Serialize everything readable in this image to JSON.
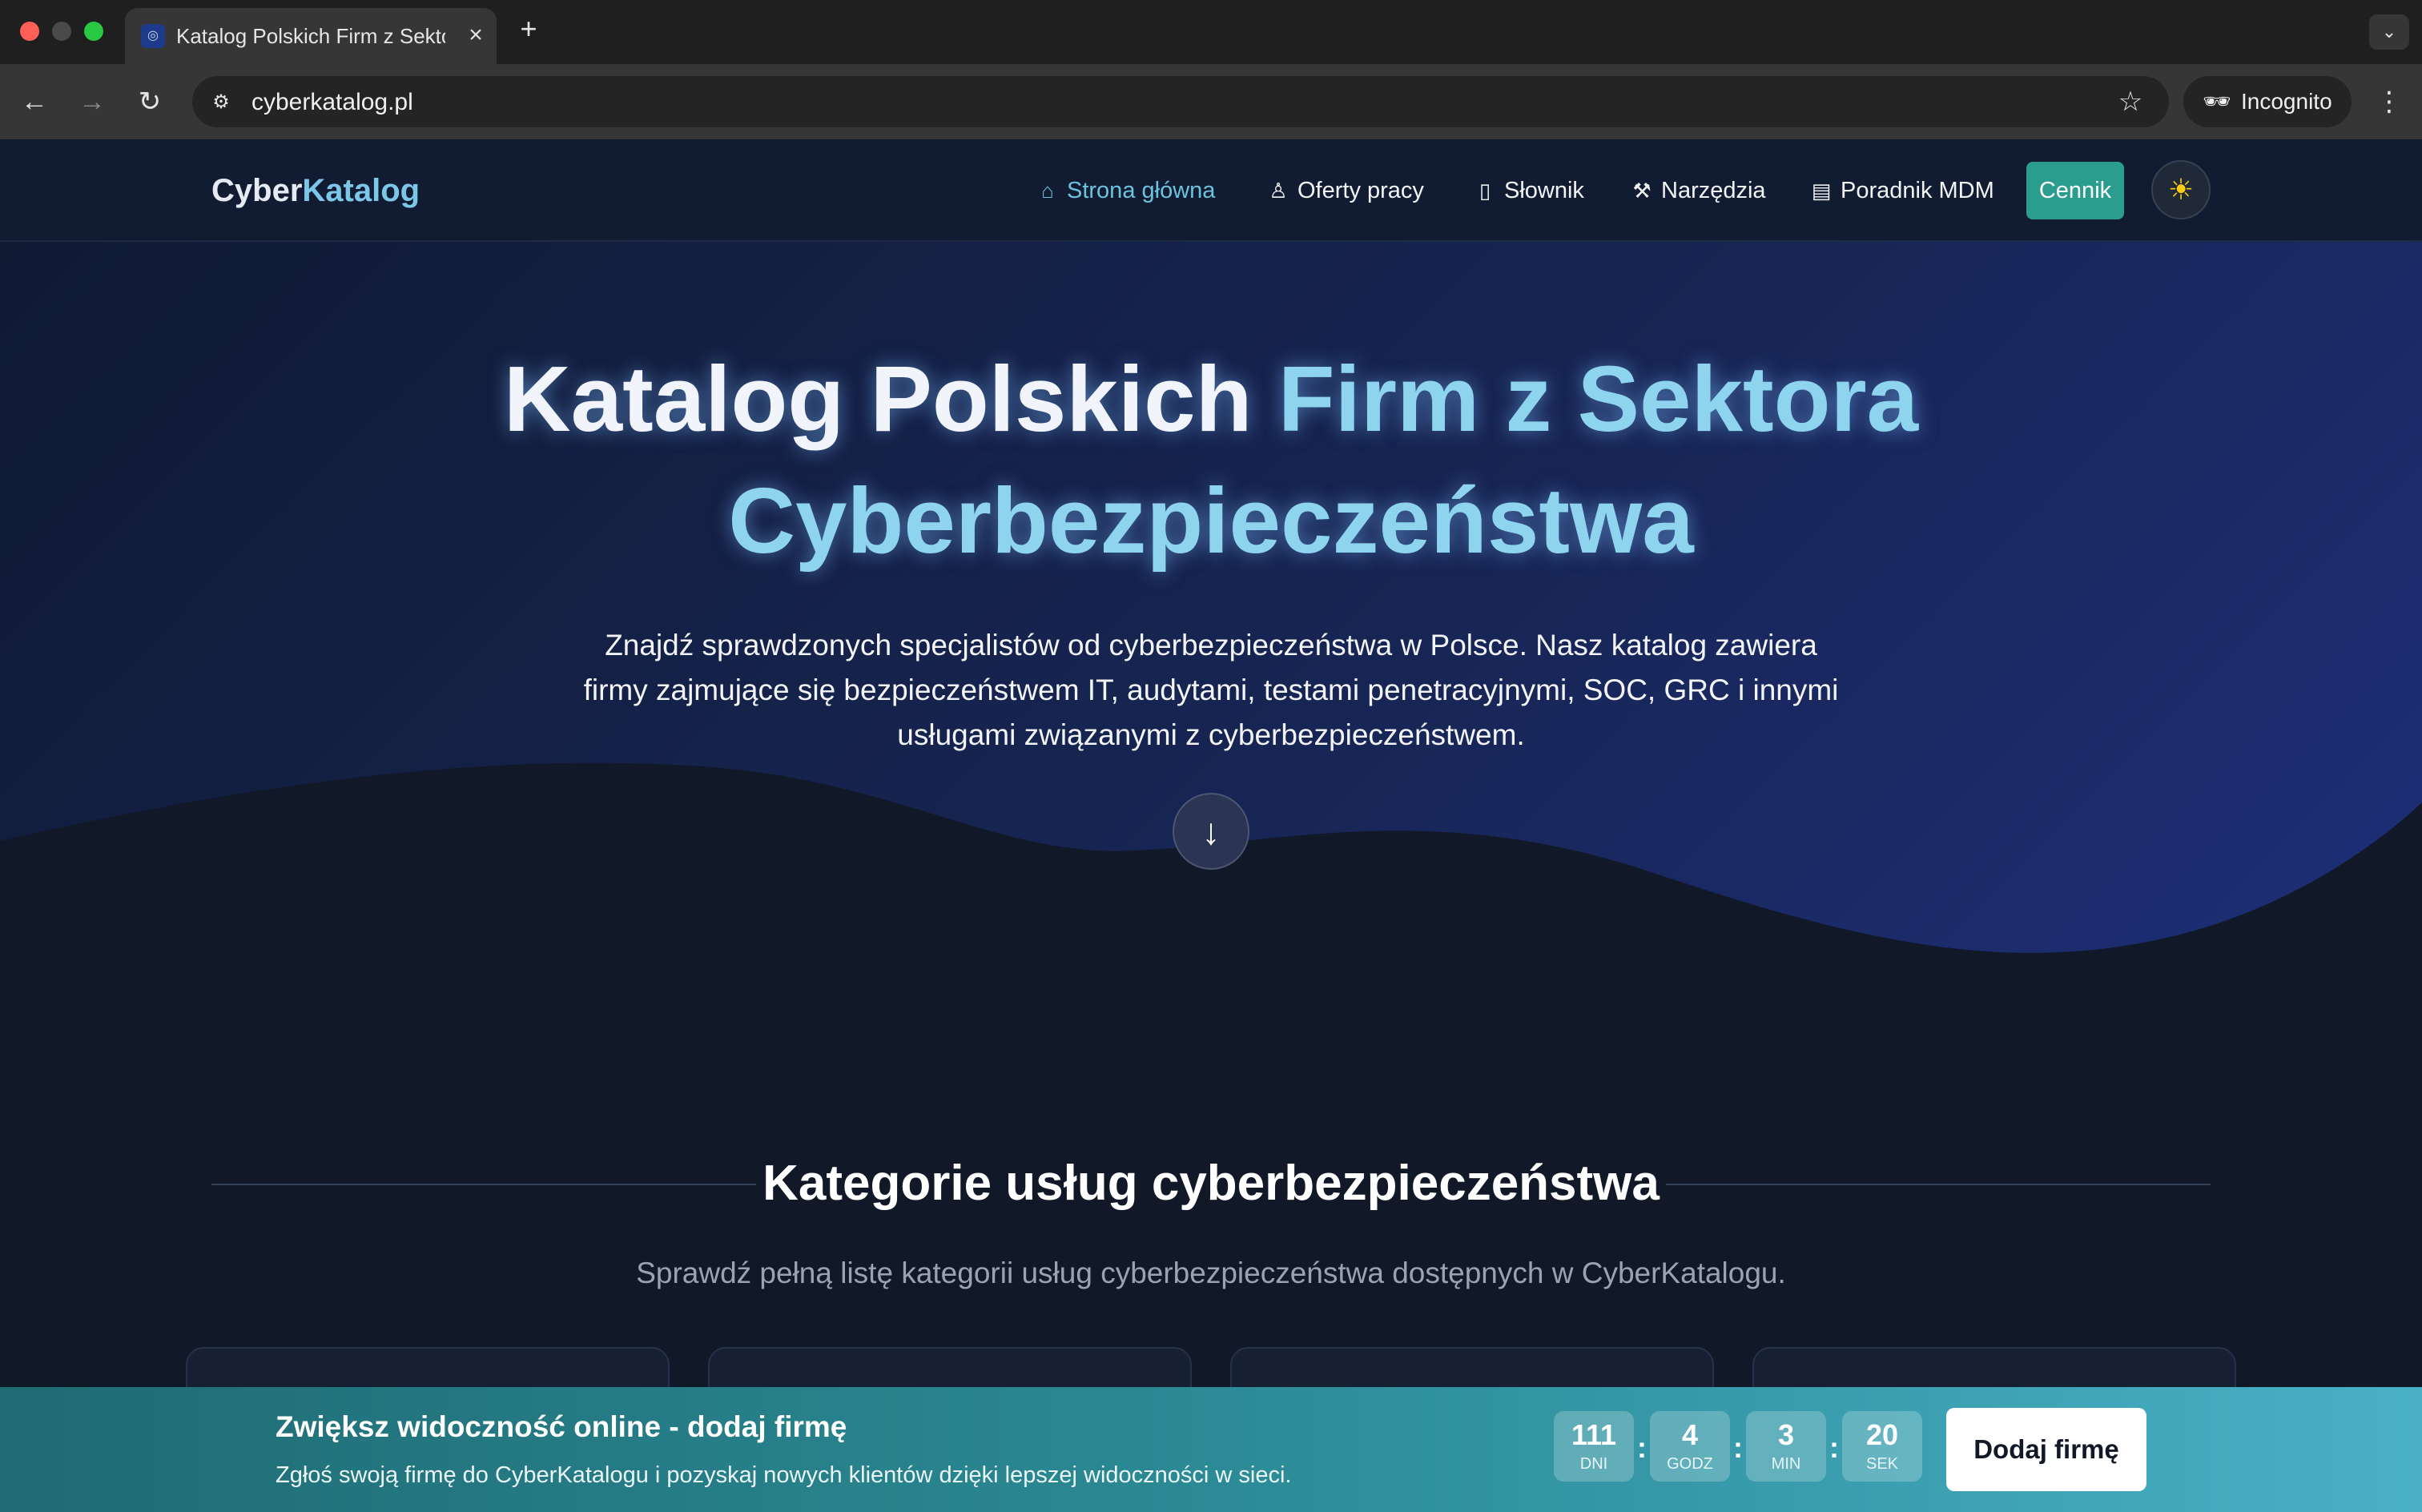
{
  "browser": {
    "tab_title": "Katalog Polskich Firm z Sektora Cyberbezpieczeństwa",
    "url": "cyberkatalog.pl",
    "incognito_label": "Incognito",
    "icons": {
      "back": "arrow-left-icon",
      "forward": "arrow-right-icon",
      "reload": "reload-icon",
      "site_info": "tune-icon",
      "bookmark": "star-icon",
      "incognito": "incognito-icon",
      "menu": "kebab-menu-icon"
    }
  },
  "header": {
    "logo_part1": "Cyber",
    "logo_part2": "Katalog",
    "nav": [
      {
        "label": "Strona główna",
        "icon": "home-icon",
        "active": true
      },
      {
        "label": "Oferty pracy",
        "icon": "user-icon",
        "active": false
      },
      {
        "label": "Słownik",
        "icon": "book-icon",
        "active": false
      },
      {
        "label": "Narzędzia",
        "icon": "wrench-icon",
        "active": false
      },
      {
        "label": "Poradnik MDM",
        "icon": "document-icon",
        "active": false
      }
    ],
    "cta_label": "Cennik",
    "theme_icon": "sun-icon"
  },
  "hero": {
    "title_part1": "Katalog Polskich ",
    "title_part2": "Firm z Sektora",
    "title_part3": "Cyberbezpieczeństwa",
    "description": "Znajdź sprawdzonych specjalistów od cyberbezpieczeństwa w Polsce. Nasz katalog zawiera firmy zajmujące się bezpieczeństwem IT, audytami, testami penetracyjnymi, SOC, GRC i innymi usługami związanymi z cyberbezpieczeństwem.",
    "scroll_icon": "arrow-down-icon"
  },
  "categories": {
    "title": "Kategorie usług cyberbezpieczeństwa",
    "subtitle": "Sprawdź pełną listę kategorii usług cyberbezpieczeństwa dostępnych w CyberKatalogu."
  },
  "promo": {
    "title": "Zwiększ widoczność online - dodaj firmę",
    "subtitle": "Zgłoś swoją firmę do CyberKatalogu i pozyskaj nowych klientów dzięki lepszej widoczności w sieci.",
    "countdown": [
      {
        "value": "111",
        "label": "DNI"
      },
      {
        "value": "4",
        "label": "GODZ"
      },
      {
        "value": "3",
        "label": "MIN"
      },
      {
        "value": "20",
        "label": "SEK"
      }
    ],
    "separator": ":",
    "button_label": "Dodaj firmę"
  },
  "colors": {
    "accent_teal": "#2a9d8f",
    "accent_cyan": "#6cc3dc",
    "background": "#111827",
    "hero_blue": "#1e2f7a"
  }
}
